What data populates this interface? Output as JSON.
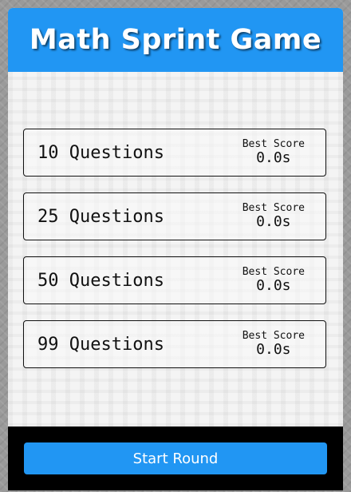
{
  "header": {
    "title": "Math Sprint Game"
  },
  "questions": [
    {
      "label": "10 Questions",
      "score_title": "Best Score",
      "score_value": "0.0s"
    },
    {
      "label": "25 Questions",
      "score_title": "Best Score",
      "score_value": "0.0s"
    },
    {
      "label": "50 Questions",
      "score_title": "Best Score",
      "score_value": "0.0s"
    },
    {
      "label": "99 Questions",
      "score_title": "Best Score",
      "score_value": "0.0s"
    }
  ],
  "footer": {
    "start_label": "Start Round"
  },
  "colors": {
    "accent": "#2196f3",
    "footer_bg": "#000000",
    "card_bg": "#f4f4f4"
  }
}
